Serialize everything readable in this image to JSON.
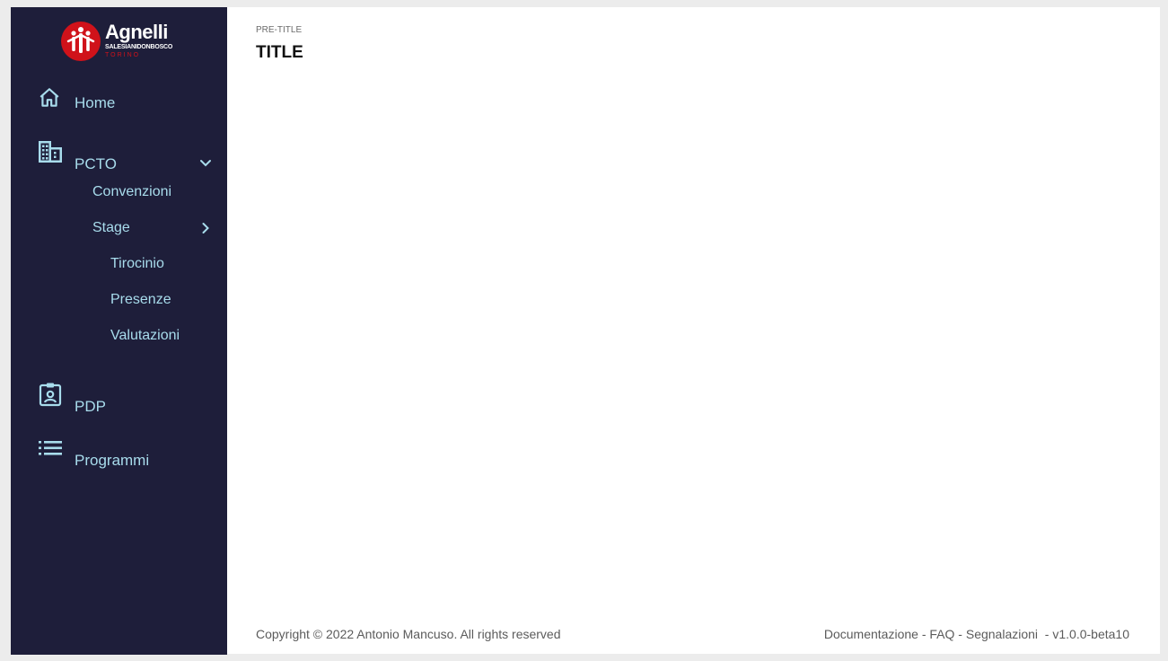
{
  "brand": {
    "name": "Agnelli",
    "subtitle": "SALESIANIDONBOSCO",
    "city": "TORINO",
    "accent": "#d0121a"
  },
  "sidebar": {
    "background": "#1e1e3a",
    "items": [
      {
        "label": "Home",
        "icon": "home-icon"
      },
      {
        "label": "PCTO",
        "icon": "building-icon",
        "expanded": true,
        "children": [
          {
            "label": "Convenzioni"
          },
          {
            "label": "Stage",
            "expanded": true,
            "children": [
              {
                "label": "Tirocinio"
              },
              {
                "label": "Presenze"
              },
              {
                "label": "Valutazioni"
              }
            ]
          }
        ]
      },
      {
        "label": "PDP",
        "icon": "id-badge-icon"
      },
      {
        "label": "Programmi",
        "icon": "list-icon"
      }
    ]
  },
  "header": {
    "pretitle": "PRE-TITLE",
    "title": "TITLE"
  },
  "footer": {
    "copyright": "Copyright © 2022 Antonio Mancuso. All rights reserved",
    "links": [
      "Documentazione",
      "FAQ",
      "Segnalazioni"
    ],
    "version": "v1.0.0-beta10"
  }
}
